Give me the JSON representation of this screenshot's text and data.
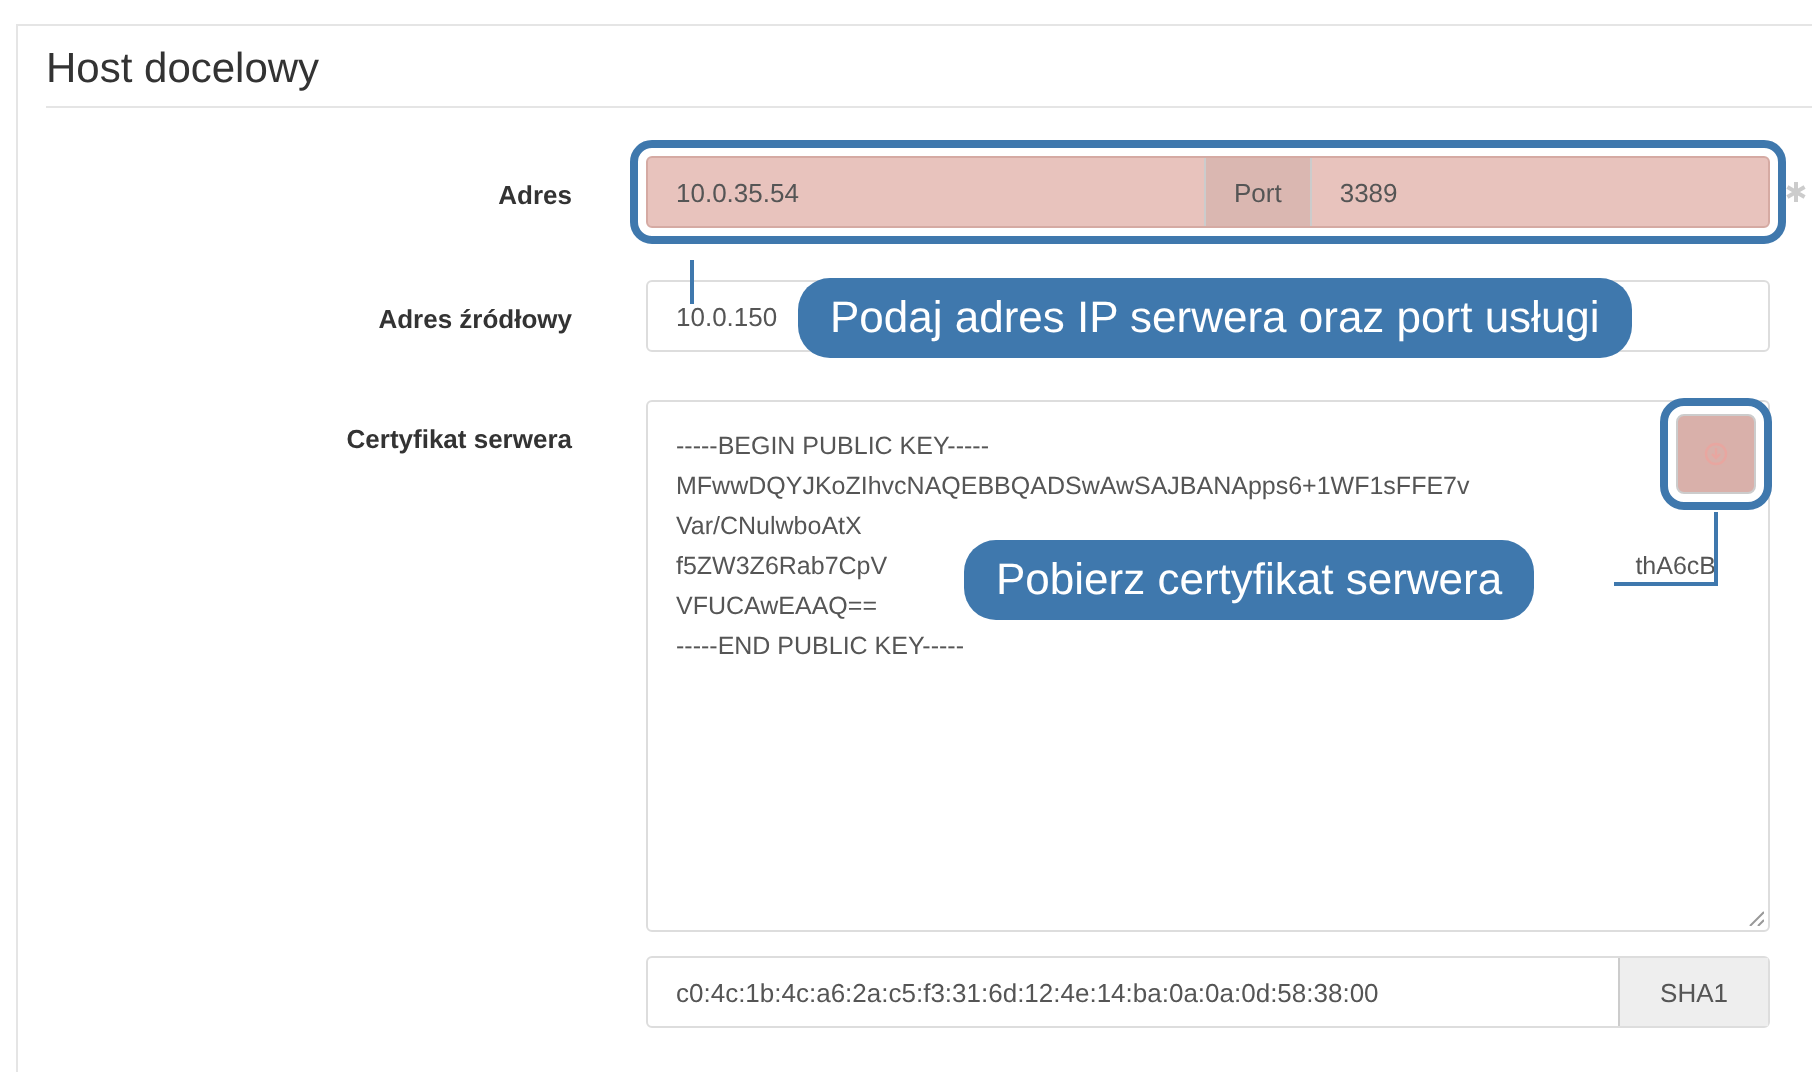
{
  "panel": {
    "title": "Host docelowy"
  },
  "address": {
    "label": "Adres",
    "value": "10.0.35.54",
    "addon": "Port",
    "port": "3389",
    "highlighted": true
  },
  "source": {
    "label": "Adres źródłowy",
    "value": "10.0.150"
  },
  "certificate": {
    "label": "Certyfikat serwera",
    "lines": [
      [
        "-----BEGIN PUBLIC KEY-----"
      ],
      [
        "MFwwDQYJKoZIhvcNAQEBBQADSwAwSAJBANApps6+1WF1sFFE7v"
      ],
      [
        "Var/CNulwboAtX"
      ],
      [
        "f5ZW3Z6Rab7CpV",
        "thA6cB"
      ],
      [
        "VFUCAwEAAQ=="
      ],
      [
        "-----END PUBLIC KEY-----"
      ]
    ],
    "fetch_highlighted": true,
    "fingerprint": "c0:4c:1b:4c:a6:2a:c5:f3:31:6d:12:4e:14:ba:0a:0a:0d:58:38:00",
    "hash": "SHA1"
  },
  "tooltips": [
    {
      "text": "Podaj adres IP serwera oraz port usługi"
    },
    {
      "text": "Pobierz certyfikat serwera"
    }
  ]
}
